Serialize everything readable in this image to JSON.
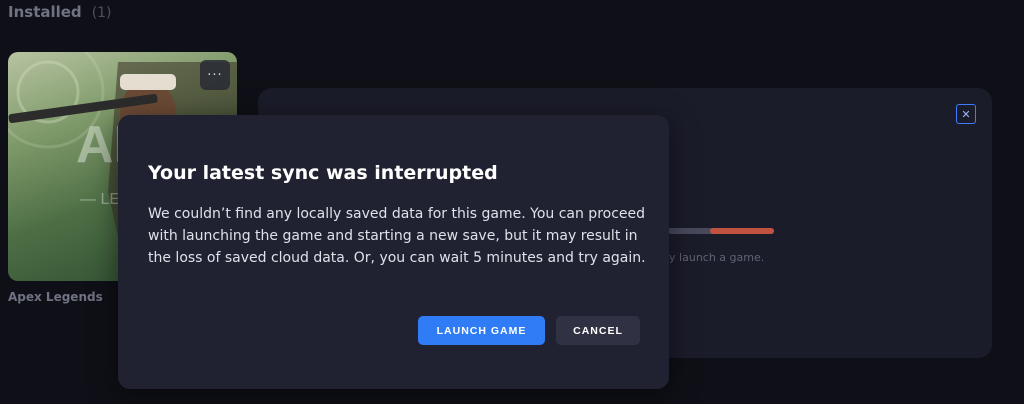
{
  "library": {
    "section_title": "Installed",
    "section_count": "(1)",
    "game": {
      "name": "Apex Legends",
      "more_icon": "more-horizontal-icon",
      "more_glyph": "···"
    }
  },
  "background_panel": {
    "close_icon": "close-icon",
    "close_glyph": "✕",
    "hint_text": "dly launch a game.",
    "progress_fraction": 0.6,
    "progress_color": "#c0533f"
  },
  "dialog": {
    "title": "Your latest sync was interrupted",
    "body": "We couldn’t find any locally saved data for this game. You can proceed with launching the game and starting a new save, but it may result in the loss of saved cloud data. Or, you can wait 5 minutes and try again.",
    "launch_label": "LAUNCH GAME",
    "cancel_label": "CANCEL",
    "accent_color": "#2f7cf6"
  }
}
